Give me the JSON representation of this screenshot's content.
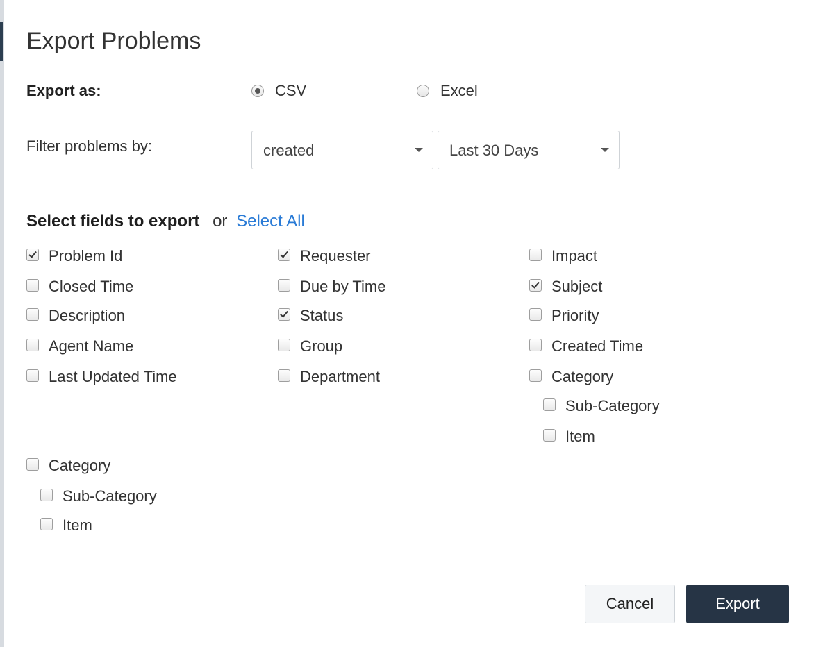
{
  "dialog": {
    "title": "Export Problems"
  },
  "export_as": {
    "label": "Export as:",
    "options": [
      {
        "label": "CSV",
        "selected": true
      },
      {
        "label": "Excel",
        "selected": false
      }
    ]
  },
  "filter": {
    "label": "Filter problems by:",
    "field_select": "created",
    "range_select": "Last 30 Days"
  },
  "fields": {
    "heading": "Select fields to export",
    "or_text": "or",
    "select_all": "Select All",
    "col1": [
      {
        "label": "Problem Id",
        "checked": true
      },
      {
        "label": "Closed Time",
        "checked": false
      },
      {
        "label": "Description",
        "checked": false
      },
      {
        "label": "Agent Name",
        "checked": false
      },
      {
        "label": "Last Updated Time",
        "checked": false
      }
    ],
    "col2": [
      {
        "label": "Requester",
        "checked": true
      },
      {
        "label": "Due by Time",
        "checked": false
      },
      {
        "label": "Status",
        "checked": true
      },
      {
        "label": "Group",
        "checked": false
      },
      {
        "label": "Department",
        "checked": false
      }
    ],
    "col3": [
      {
        "label": "Impact",
        "checked": false
      },
      {
        "label": "Subject",
        "checked": true
      },
      {
        "label": "Priority",
        "checked": false
      },
      {
        "label": "Created Time",
        "checked": false
      },
      {
        "label": "Category",
        "checked": false
      }
    ],
    "col3_sub": [
      {
        "label": "Sub-Category",
        "checked": false
      },
      {
        "label": "Item",
        "checked": false
      }
    ],
    "extra": {
      "label": "Category",
      "checked": false
    },
    "extra_sub": [
      {
        "label": "Sub-Category",
        "checked": false
      },
      {
        "label": "Item",
        "checked": false
      }
    ]
  },
  "buttons": {
    "cancel": "Cancel",
    "export": "Export"
  },
  "colors": {
    "primary_button": "#263445",
    "link": "#2a7bd6"
  }
}
